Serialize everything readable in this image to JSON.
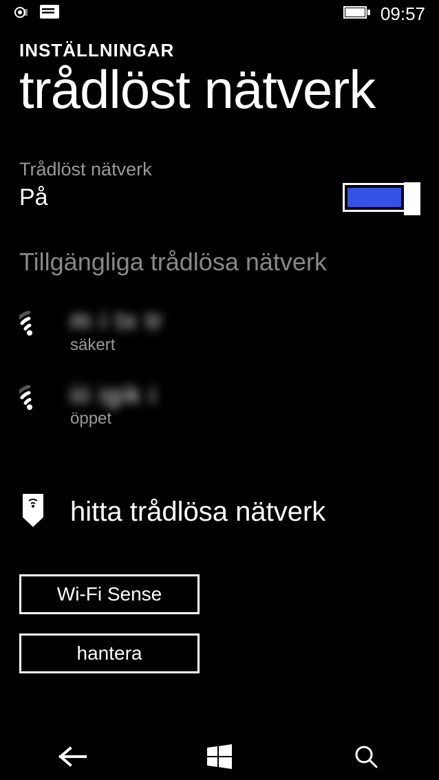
{
  "status_bar": {
    "time": "09:57"
  },
  "breadcrumb": "INSTÄLLNINGAR",
  "page_title": "trådlöst nätverk",
  "wifi_toggle": {
    "label": "Trådlöst nätverk",
    "state": "På"
  },
  "available_networks_header": "Tillgängliga trådlösa nätverk",
  "networks": [
    {
      "name": "m i tx tr",
      "security": "säkert"
    },
    {
      "name": "iii igik i",
      "security": "öppet"
    }
  ],
  "find_networks_label": "hitta trådlösa nätverk",
  "buttons": {
    "wifi_sense": "Wi-Fi Sense",
    "manage": "hantera"
  }
}
